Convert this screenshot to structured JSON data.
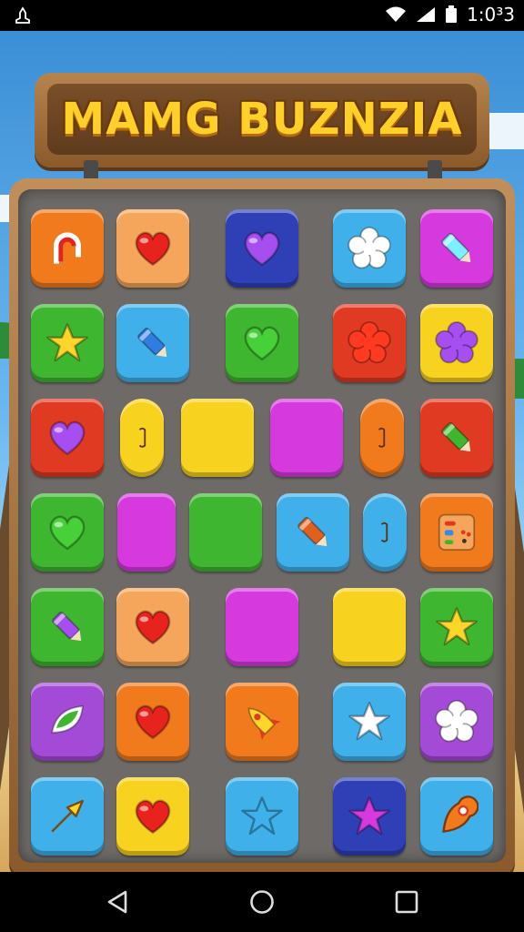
{
  "status_bar": {
    "time": "1:0³3"
  },
  "game": {
    "title": "MAMG BUZNZIA",
    "colors": {
      "orange": "#f07a1c",
      "peach": "#f5a65a",
      "blue": "#2f8ee0",
      "navy": "#2f3fb6",
      "purple": "#a34ad6",
      "magenta": "#d63adf",
      "green": "#3fb62f",
      "red": "#e13a22",
      "yellow": "#f7d21f",
      "cyan": "#3fb0ea"
    },
    "grid": [
      [
        {
          "name": "tile-r1c1",
          "bg": "orange",
          "icon": "ring-icon",
          "shape": "square"
        },
        {
          "name": "tile-r1c2",
          "bg": "peach",
          "icon": "heart-icon",
          "iconColor": "#e8221c",
          "shape": "square"
        },
        {
          "name": "tile-r1c3",
          "bg": "navy",
          "icon": "heart-icon",
          "iconColor": "#a64ef0",
          "shape": "square"
        },
        {
          "name": "tile-r1c4",
          "bg": "cyan",
          "icon": "flower-icon",
          "iconColor": "#ffffff",
          "shape": "square"
        },
        {
          "name": "tile-r1c5",
          "bg": "magenta",
          "icon": "crayon-icon",
          "iconColor": "#7cf0ff",
          "shape": "square"
        }
      ],
      [
        {
          "name": "tile-r2c1",
          "bg": "green",
          "icon": "star-icon",
          "iconColor": "#ffd52a",
          "shape": "square"
        },
        {
          "name": "tile-r2c2",
          "bg": "cyan",
          "icon": "crayon-icon",
          "iconColor": "#2f7de0",
          "shape": "square"
        },
        {
          "name": "tile-r2c3",
          "bg": "green",
          "icon": "heart-icon",
          "iconColor": "#48d038",
          "shape": "square"
        },
        {
          "name": "tile-r2c4",
          "bg": "red",
          "icon": "flower-icon",
          "iconColor": "#ff3a20",
          "shape": "square"
        },
        {
          "name": "tile-r2c5",
          "bg": "yellow",
          "icon": "flower-icon",
          "iconColor": "#a64ef0",
          "shape": "square"
        }
      ],
      [
        {
          "name": "tile-r3c1",
          "bg": "red",
          "icon": "heart-icon",
          "iconColor": "#a64ef0",
          "shape": "square"
        },
        {
          "name": "tile-r3c2",
          "bg": "yellow",
          "icon": "capsule-icon",
          "iconColor": "#f7d21f",
          "shape": "pill"
        },
        {
          "name": "tile-r3c3",
          "bg": "yellow",
          "icon": "",
          "shape": "square"
        },
        {
          "name": "tile-r3c4",
          "bg": "magenta",
          "icon": "",
          "shape": "wide"
        },
        {
          "name": "tile-r3c5",
          "bg": "orange",
          "icon": "capsule-icon",
          "iconColor": "#f07a1c",
          "shape": "pill"
        },
        {
          "name": "tile-r3c6",
          "bg": "red",
          "icon": "crayon-icon",
          "iconColor": "#3fb62f",
          "shape": "square"
        }
      ],
      [
        {
          "name": "tile-r4c1",
          "bg": "green",
          "icon": "heart-icon",
          "iconColor": "#48d038",
          "shape": "square"
        },
        {
          "name": "tile-r4c2",
          "bg": "magenta",
          "icon": "",
          "shape": "narrow"
        },
        {
          "name": "tile-r4c3",
          "bg": "green",
          "icon": "",
          "shape": "square"
        },
        {
          "name": "tile-r4c4",
          "bg": "cyan",
          "icon": "crayon-icon",
          "iconColor": "#e0601c",
          "shape": "square"
        },
        {
          "name": "tile-r4c5",
          "bg": "cyan",
          "icon": "capsule-icon",
          "iconColor": "#3fb0ea",
          "shape": "pill"
        },
        {
          "name": "tile-r4c6",
          "bg": "orange",
          "icon": "palette-icon",
          "iconColor": "#f5a65a",
          "shape": "square"
        }
      ],
      [
        {
          "name": "tile-r5c1",
          "bg": "green",
          "icon": "crayon-icon",
          "iconColor": "#a64ef0",
          "shape": "square"
        },
        {
          "name": "tile-r5c2",
          "bg": "peach",
          "icon": "heart-icon",
          "iconColor": "#e8221c",
          "shape": "square"
        },
        {
          "name": "tile-r5c3",
          "bg": "magenta",
          "icon": "",
          "shape": "square"
        },
        {
          "name": "tile-r5c4",
          "bg": "yellow",
          "icon": "",
          "shape": "square"
        },
        {
          "name": "tile-r5c5",
          "bg": "green",
          "icon": "star-icon",
          "iconColor": "#ffd52a",
          "shape": "square"
        }
      ],
      [
        {
          "name": "tile-r6c1",
          "bg": "purple",
          "icon": "leaf-icon",
          "iconColor": "#3fb62f",
          "shape": "square"
        },
        {
          "name": "tile-r6c2",
          "bg": "orange",
          "icon": "heart-icon",
          "iconColor": "#e8221c",
          "shape": "square"
        },
        {
          "name": "tile-r6c3",
          "bg": "orange",
          "icon": "rocket-icon",
          "iconColor": "#ffd52a",
          "shape": "square"
        },
        {
          "name": "tile-r6c4",
          "bg": "cyan",
          "icon": "star-icon",
          "iconColor": "#ffffff",
          "shape": "square"
        },
        {
          "name": "tile-r6c5",
          "bg": "purple",
          "icon": "flower-icon",
          "iconColor": "#ffffff",
          "shape": "square"
        }
      ],
      [
        {
          "name": "tile-r7c1",
          "bg": "cyan",
          "icon": "arrow-icon",
          "iconColor": "#ffd52a",
          "shape": "square"
        },
        {
          "name": "tile-r7c2",
          "bg": "yellow",
          "icon": "heart-icon",
          "iconColor": "#e8221c",
          "shape": "square"
        },
        {
          "name": "tile-r7c3",
          "bg": "cyan",
          "icon": "star-icon",
          "iconColor": "#3fb0ea",
          "shape": "square"
        },
        {
          "name": "tile-r7c4",
          "bg": "navy",
          "icon": "star-icon",
          "iconColor": "#d63adf",
          "shape": "square"
        },
        {
          "name": "tile-r7c5",
          "bg": "cyan",
          "icon": "pin-icon",
          "iconColor": "#f07a1c",
          "shape": "square"
        }
      ]
    ]
  },
  "nav": {
    "back": "back-icon",
    "home": "home-icon",
    "recents": "recents-icon"
  }
}
